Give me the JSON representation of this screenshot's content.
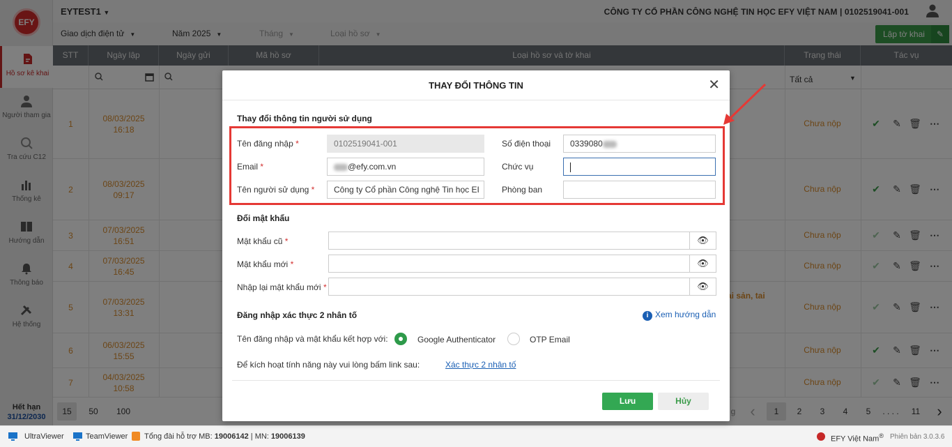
{
  "app": {
    "logo": "EFY",
    "account": "EYTEST1",
    "company_prefix": "CÔNG TY CỔ PHẦN CÔNG NGHỆ TIN HỌC EFY VIỆT NAM | ",
    "company_tax": "0102519041-001"
  },
  "sidebar": {
    "items": [
      {
        "label": "Hồ sơ kê khai",
        "icon": "file-edit-icon"
      },
      {
        "label": "Người tham gia",
        "icon": "person-icon"
      },
      {
        "label": "Tra cứu C12",
        "icon": "search-icon"
      },
      {
        "label": "Thống kê",
        "icon": "bar-chart-icon"
      },
      {
        "label": "Hướng dẫn",
        "icon": "book-icon"
      },
      {
        "label": "Thông báo",
        "icon": "bell-icon"
      },
      {
        "label": "Hệ thống",
        "icon": "tools-icon"
      }
    ],
    "expire_label": "Hết hạn",
    "expire_date": "31/12/2030"
  },
  "filters": {
    "transaction": "Giao dịch điện tử",
    "year": "Năm 2025",
    "month": "Tháng",
    "doc_type": "Loại hồ sơ",
    "create_btn": "Lập tờ khai"
  },
  "table": {
    "headers": [
      "STT",
      "Ngày lập",
      "Ngày gửi",
      "Mã hồ sơ",
      "Loại hồ sơ và tờ khai",
      "Trạng thái",
      "Tác vụ"
    ],
    "status_filter": "Tất cả",
    "rows": [
      {
        "stt": "1",
        "date": "08/03/2025",
        "time": "16:18",
        "status": "Chưa nộp"
      },
      {
        "stt": "2",
        "date": "08/03/2025",
        "time": "09:17",
        "status": "Chưa nộp"
      },
      {
        "stt": "3",
        "date": "07/03/2025",
        "time": "16:51",
        "status": "Chưa nộp"
      },
      {
        "stt": "4",
        "date": "07/03/2025",
        "time": "16:45",
        "status": "Chưa nộp"
      },
      {
        "stt": "5",
        "date": "07/03/2025",
        "time": "13:31",
        "status": "Chưa nộp"
      },
      {
        "stt": "6",
        "date": "06/03/2025",
        "time": "15:55",
        "status": "Chưa nộp"
      },
      {
        "stt": "7",
        "date": "04/03/2025",
        "time": "10:58",
        "status": "Chưa nộp"
      }
    ],
    "partial_text": "ai sản, tai"
  },
  "pager": {
    "sizes": [
      "15",
      "50",
      "100"
    ],
    "pages": [
      "1",
      "2",
      "3",
      "4",
      "5",
      ". . . .",
      "11"
    ],
    "prev": "‹",
    "next": "›",
    "partial": "g"
  },
  "footer": {
    "ultraviewer": "UltraViewer",
    "teamviewer": "TeamViewer",
    "hotline_prefix": "Tổng đài hỗ trợ MB: ",
    "hotline_mb": "19006142",
    "hotline_sep": " | MN: ",
    "hotline_mn": "19006139",
    "brand": "EFY Việt Nam",
    "reg": "®",
    "version": "Phiên bản 3.0.3.6"
  },
  "modal": {
    "title": "THAY ĐỔI THÔNG TIN",
    "user_section": "Thay đổi thông tin người sử dụng",
    "username_label": "Tên đăng nhập",
    "username_value": "0102519041-001",
    "phone_label": "Số điện thoại",
    "phone_value": "0339080",
    "email_label": "Email",
    "email_value": "@efy.com.vn",
    "position_label": "Chức vụ",
    "position_value": "",
    "fullname_label": "Tên người sử dụng",
    "fullname_value": "Công ty Cổ phần Công nghệ Tin học EI",
    "dept_label": "Phòng ban",
    "dept_value": "",
    "password_section": "Đổi mật khẩu",
    "old_pw_label": "Mật khẩu cũ",
    "new_pw_label": "Mật khẩu mới",
    "confirm_pw_label": "Nhập lại mật khẩu mới",
    "twofa_section": "Đăng nhập xác thực 2 nhân tố",
    "guide_link": "Xem hướng dẫn",
    "combine_label": "Tên đăng nhập và mật khẩu kết hợp với:",
    "opt_google": "Google Authenticator",
    "opt_otp": "OTP Email",
    "activate_label": "Để kích hoạt tính năng này vui lòng bấm link sau:",
    "activate_link": "Xác thực 2 nhân tố",
    "save": "Lưu",
    "cancel": "Hủy"
  },
  "colors": {
    "accent": "#3a9b49",
    "brand": "#c62828",
    "status": "#d88a2a",
    "highlight": "#e53935"
  }
}
